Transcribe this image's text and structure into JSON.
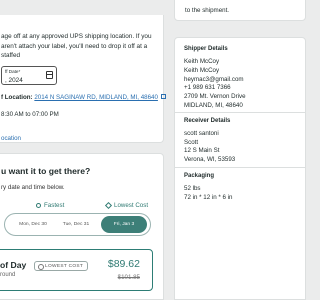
{
  "dropoff": {
    "text": "age off at any approved UPS shipping location. If you aren't attach your label, you'll need to drop it off at a staffed",
    "date_label": "ff Date*",
    "date_value": ", 2024",
    "location_label": "f Location:",
    "location_link": "2014 N SAGINAW RD, MIDLAND, MI, 48640",
    "hours": "8:30 AM to 07:00 PM",
    "location_link2": "ocation"
  },
  "delivery": {
    "question": "u want it to get there?",
    "subtitle": "ry date and time below.",
    "option_fastest": "Fastest",
    "option_lowest": "Lowest Cost",
    "days": [
      "Mon, Dec 30",
      "Tue, Dec 31",
      "Fri, Jan 3"
    ],
    "selected_day": "Fri, Jan 3",
    "offer_title": "of Day",
    "offer_sub": "round",
    "badge": "LOWEST COST",
    "price": "$89.62",
    "old_price": "$101.85"
  },
  "shipment_note": "to the shipment.",
  "shipper": {
    "title": "Shipper Details",
    "lines": [
      "Keith McCoy",
      "Keith McCoy",
      "heymac3@gmail.com",
      "+1 989 631 7366",
      "2709 Mt. Vernon Drive",
      "MIDLAND, MI, 48640"
    ]
  },
  "receiver": {
    "title": "Receiver Details",
    "lines": [
      "scott santoni",
      "Scott",
      "12 S Main St",
      "Verona, WI, 53593"
    ]
  },
  "packaging": {
    "title": "Packaging",
    "lines": [
      "52 lbs",
      "72 in * 12 in * 6 in"
    ]
  },
  "colors": {
    "accent": "#3d7f78",
    "link": "#2a6fb0",
    "background": "#ebecec"
  }
}
